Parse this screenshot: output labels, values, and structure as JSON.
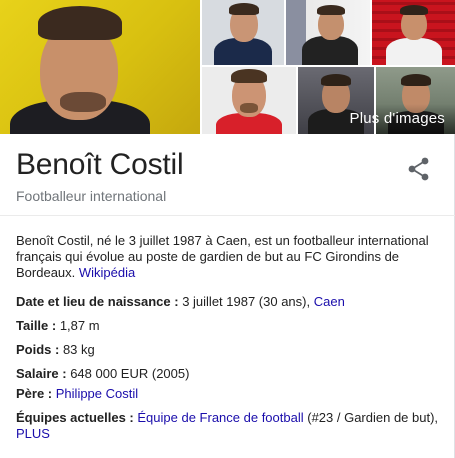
{
  "photos": {
    "more_label": "Plus d'images"
  },
  "header": {
    "title": "Benoît Costil",
    "subtitle": "Footballeur international"
  },
  "description": {
    "text": "Benoît Costil, né le 3 juillet 1987 à Caen, est un footballeur international français qui évolue au poste de gardien de but au FC Girondins de Bordeaux. ",
    "source_link": "Wikipédia"
  },
  "facts": {
    "birth": {
      "label": "Date et lieu de naissance :",
      "value": " 3 juillet 1987 (30 ans), ",
      "link": "Caen"
    },
    "height": {
      "label": "Taille :",
      "value": " 1,87 m"
    },
    "weight": {
      "label": "Poids :",
      "value": " 83 kg"
    },
    "salary": {
      "label": "Salaire :",
      "value": " 648 000 EUR (2005)"
    },
    "father": {
      "label": "Père :",
      "link": "Philippe Costil"
    },
    "teams": {
      "label": "Équipes actuelles :",
      "link": "Équipe de France de football",
      "value": " (#23 / Gardien de but),",
      "more": "PLUS"
    }
  },
  "colors": {
    "link": "#1a0dab",
    "subtitle": "#70757a",
    "title": "#222222"
  }
}
